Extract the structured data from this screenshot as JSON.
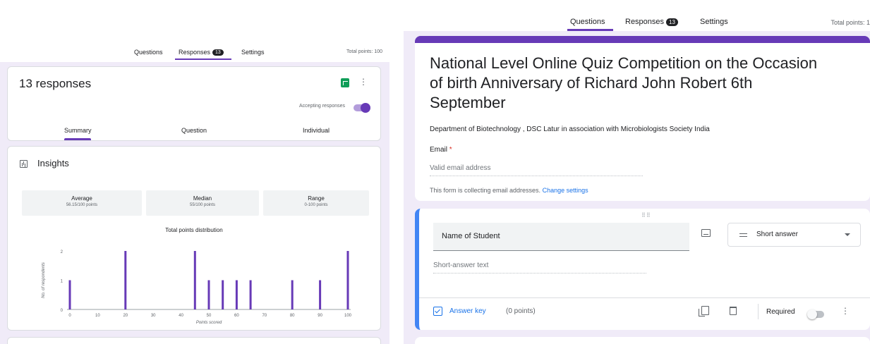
{
  "left": {
    "tabs": [
      {
        "label": "Questions"
      },
      {
        "label": "Responses",
        "badge": "13"
      },
      {
        "label": "Settings"
      }
    ],
    "total_points": "Total points: 100",
    "responses_title": "13 responses",
    "accepting_label": "Accepting responses",
    "subtabs": [
      {
        "label": "Summary"
      },
      {
        "label": "Question"
      },
      {
        "label": "Individual"
      }
    ],
    "insights_title": "Insights",
    "stats": [
      {
        "label": "Average",
        "value": "56.15/100 points"
      },
      {
        "label": "Median",
        "value": "55/100 points"
      },
      {
        "label": "Range",
        "value": "0-100 points"
      }
    ]
  },
  "right": {
    "tabs": [
      {
        "label": "Questions"
      },
      {
        "label": "Responses",
        "badge": "13"
      },
      {
        "label": "Settings"
      }
    ],
    "total_points": "Total points: 1",
    "form_title": "National Level Online Quiz Competition on the Occasion of birth Anniversary of Richard John Robert 6th September",
    "form_description": "Department of Biotechnology , DSC Latur in association with Microbiologists Society India",
    "email_label": "Email",
    "email_required_mark": "*",
    "email_placeholder": "Valid email address",
    "email_note": "This form is collecting email addresses.",
    "email_note_link": "Change settings",
    "question_title": "Name of Student",
    "question_type": "Short answer",
    "short_answer_placeholder": "Short-answer text",
    "answer_key": "Answer key",
    "answer_points": "(0 points)",
    "required_label": "Required"
  },
  "colors": {
    "accent": "#673ab7",
    "blue": "#1a73e8",
    "background": "#f0ebf8"
  },
  "chart_data": {
    "type": "bar",
    "title": "Total points distribution",
    "xlabel": "Points scored",
    "ylabel": "No. of respondents",
    "x": [
      0,
      20,
      45,
      50,
      55,
      60,
      65,
      80,
      90,
      100
    ],
    "values": [
      1,
      2,
      2,
      1,
      1,
      1,
      1,
      1,
      1,
      2
    ],
    "xticks": [
      0,
      10,
      20,
      30,
      40,
      50,
      60,
      70,
      80,
      90,
      100
    ],
    "yticks": [
      0,
      1,
      2
    ],
    "xlim": [
      0,
      100
    ],
    "ylim": [
      0,
      2
    ],
    "bar_color": "#673ab7"
  }
}
